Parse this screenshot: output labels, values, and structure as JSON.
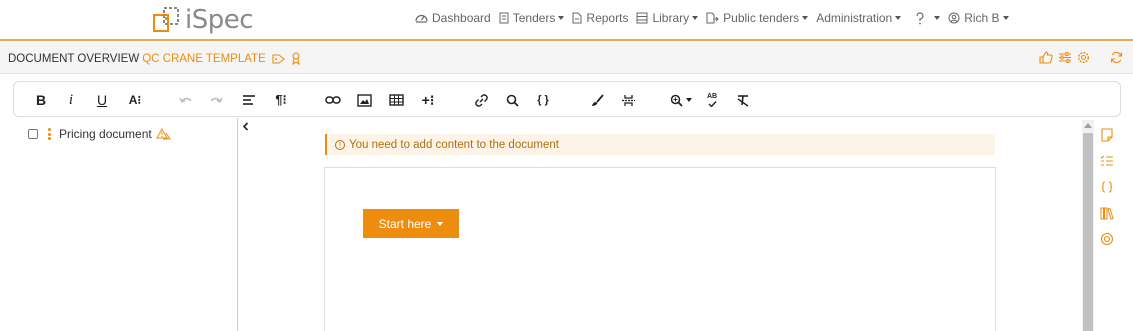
{
  "app": {
    "name": "iSpec"
  },
  "nav": {
    "items": [
      {
        "label": "Dashboard",
        "icon": "dashboard-icon",
        "has_dropdown": false
      },
      {
        "label": "Tenders",
        "icon": "tenders-icon",
        "has_dropdown": true
      },
      {
        "label": "Reports",
        "icon": "reports-icon",
        "has_dropdown": false
      },
      {
        "label": "Library",
        "icon": "library-icon",
        "has_dropdown": true
      },
      {
        "label": "Public tenders",
        "icon": "public-tenders-icon",
        "has_dropdown": true
      },
      {
        "label": "Administration",
        "icon": "",
        "has_dropdown": true
      }
    ],
    "help_icon": "help-icon",
    "user": {
      "name": "Rich B",
      "icon": "user-circle-icon"
    }
  },
  "doc_header": {
    "label": "DOCUMENT OVERVIEW",
    "template_name": "QC CRANE TEMPLATE",
    "icons": [
      "tag-icon",
      "award-icon"
    ],
    "right_icons": [
      "thumbs-up-icon",
      "sliders-icon",
      "settings-icon",
      "refresh-icon"
    ]
  },
  "toolbar": {
    "buttons": [
      "bold",
      "italic",
      "underline",
      "font-size",
      "undo",
      "redo",
      "align",
      "paragraph",
      "link",
      "image",
      "table",
      "insert",
      "hyperlink",
      "find",
      "code-view",
      "format-painter",
      "page-break",
      "zoom",
      "spellcheck",
      "clear-formatting"
    ],
    "bold_label": "B",
    "italic_label": "i",
    "underline_label": "U",
    "fontsize_label": "A⁝",
    "paragraph_label": "¶⁝",
    "insert_label": "+⁝",
    "code_label": "{ }",
    "spell_label": "AB"
  },
  "tree": {
    "items": [
      {
        "label": "Pricing document",
        "warning": true
      }
    ]
  },
  "message": {
    "text": "You need to add content to the document",
    "icon": "info-icon"
  },
  "editor": {
    "start_label": "Start here"
  },
  "side_icons": [
    "note-icon",
    "checklist-icon",
    "braces-icon",
    "books-icon",
    "target-icon"
  ],
  "colors": {
    "accent": "#ee8c0e",
    "accent_light": "#fdf3e7",
    "border": "#f0a444"
  }
}
